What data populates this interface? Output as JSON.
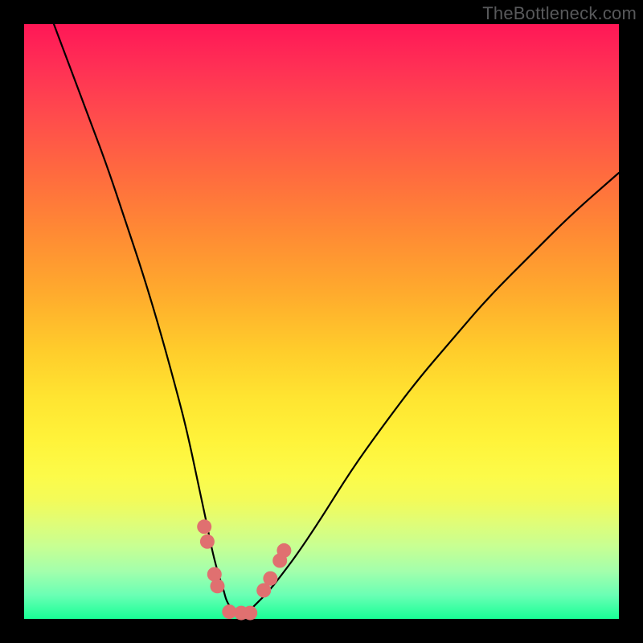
{
  "watermark": "TheBottleneck.com",
  "colors": {
    "background": "#000000",
    "curve_stroke": "#000000",
    "dot_fill": "#e07070",
    "gradient_top": "#ff1756",
    "gradient_bottom": "#18ff96"
  },
  "chart_data": {
    "type": "line",
    "title": "",
    "xlabel": "",
    "ylabel": "",
    "xlim": [
      0,
      100
    ],
    "ylim": [
      0,
      100
    ],
    "grid": false,
    "legend": false,
    "series": [
      {
        "name": "curve",
        "x": [
          5,
          8,
          11,
          14,
          17,
          20,
          23,
          26,
          27.5,
          29,
          30.5,
          31.5,
          32.5,
          33.5,
          34,
          35,
          36,
          37,
          38,
          39,
          41,
          43,
          46,
          50,
          55,
          60,
          66,
          72,
          78,
          85,
          92,
          100
        ],
        "y": [
          100,
          92,
          84,
          76,
          67,
          58,
          48,
          37,
          31,
          24,
          17,
          12,
          8,
          5,
          3,
          1.5,
          1,
          1,
          1.5,
          2.5,
          4.5,
          7,
          11,
          17,
          25,
          32,
          40,
          47,
          54,
          61,
          68,
          75
        ]
      }
    ],
    "dots": [
      {
        "x": 30.3,
        "y": 15.5
      },
      {
        "x": 30.8,
        "y": 13.0
      },
      {
        "x": 32.0,
        "y": 7.5
      },
      {
        "x": 32.5,
        "y": 5.5
      },
      {
        "x": 34.5,
        "y": 1.2
      },
      {
        "x": 36.5,
        "y": 1.0
      },
      {
        "x": 38.0,
        "y": 1.0
      },
      {
        "x": 40.3,
        "y": 4.8
      },
      {
        "x": 41.4,
        "y": 6.8
      },
      {
        "x": 43.0,
        "y": 9.8
      },
      {
        "x": 43.7,
        "y": 11.5
      }
    ],
    "notes": "Values are approximate readings from an unlabeled plot with no axes; x and y are normalized to the 0–100 range of the visible plot area. The curve descends steeply from top-left to a minimum near x≈36 and rises more gradually toward the right. Dots cluster around the minimum."
  }
}
